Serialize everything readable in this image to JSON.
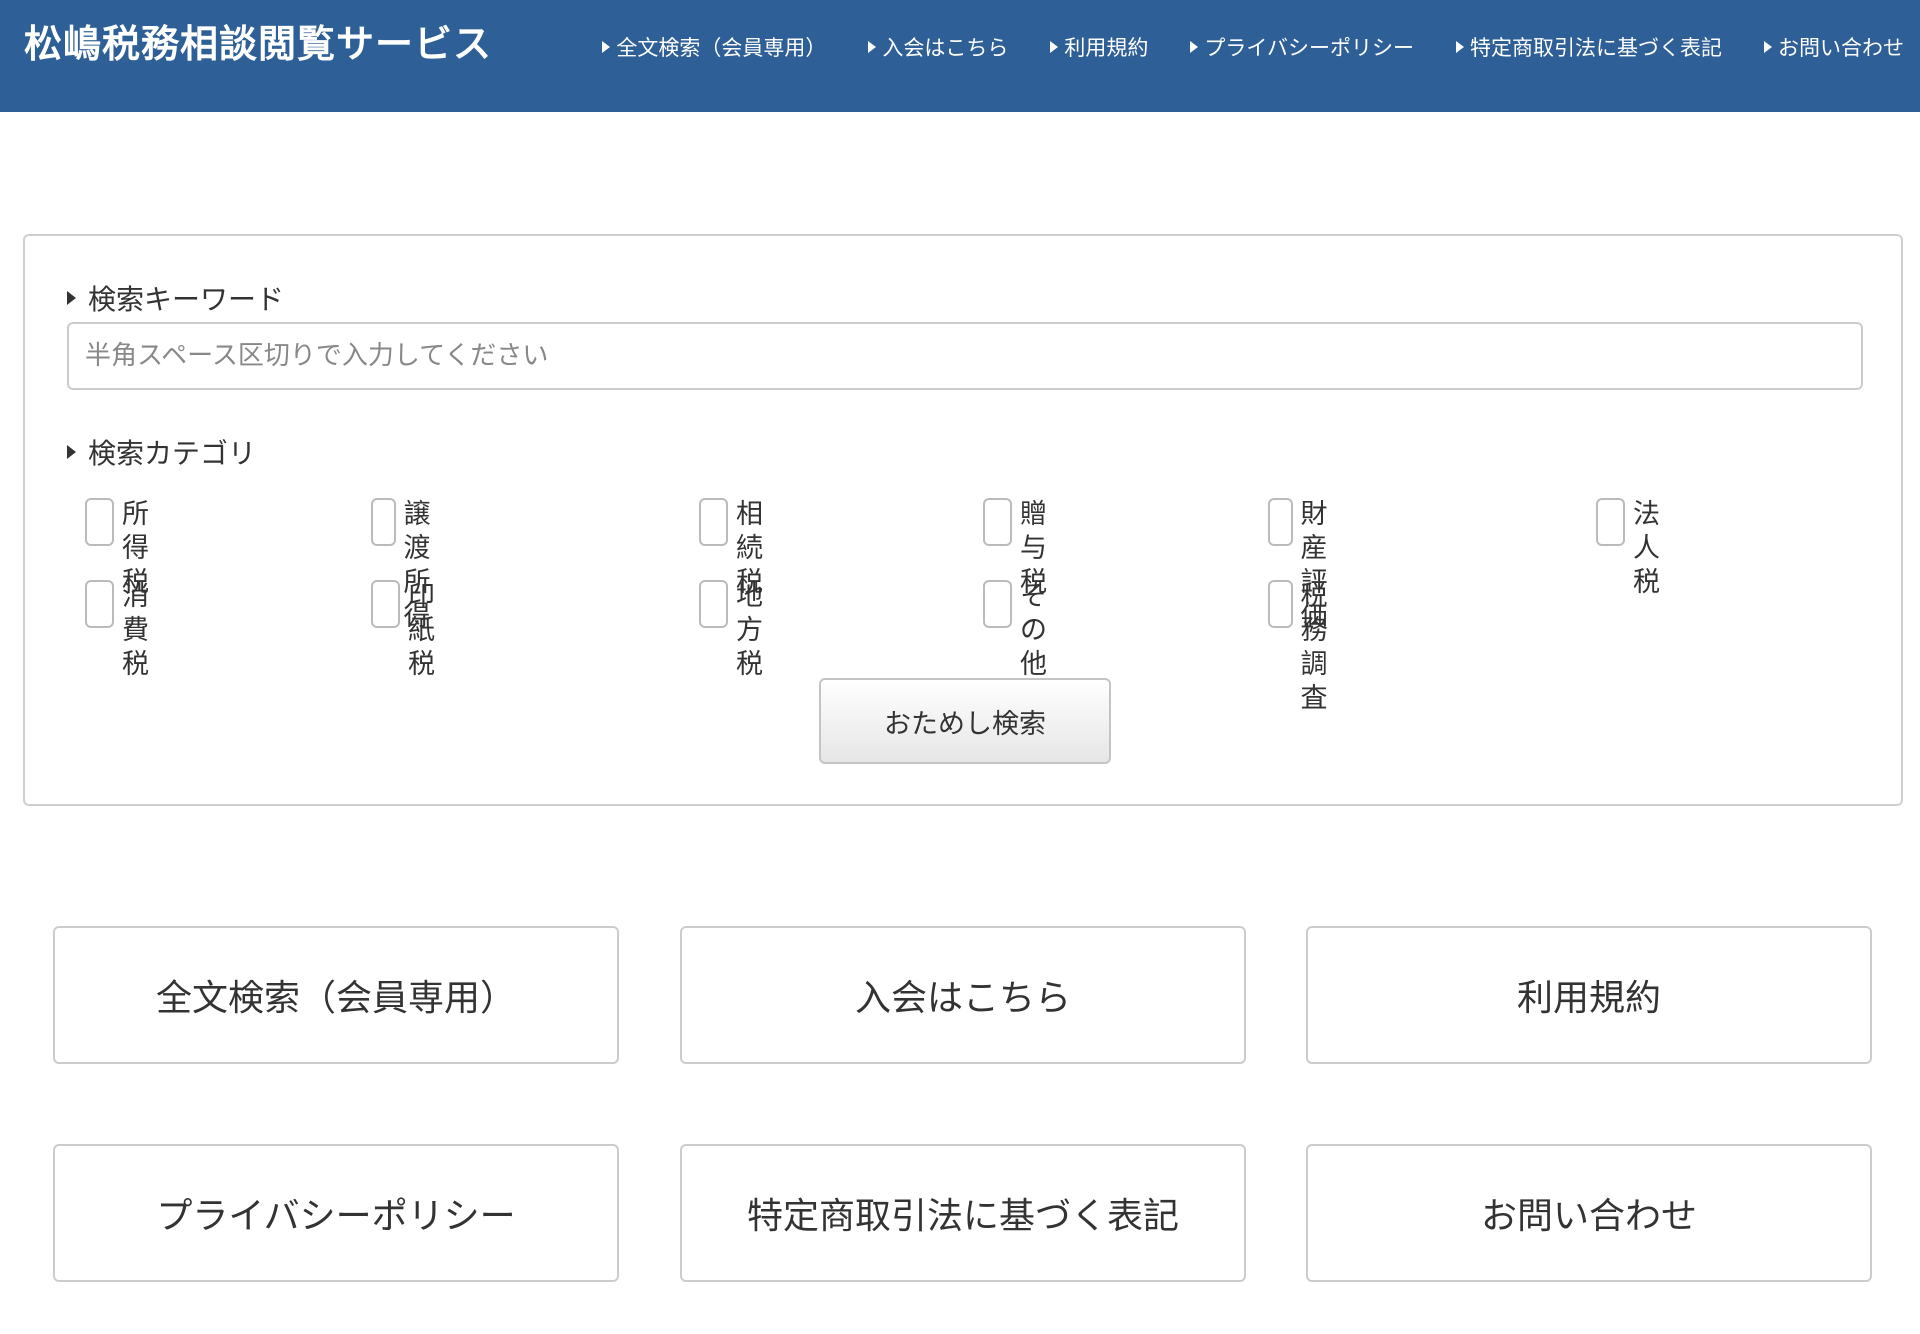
{
  "header": {
    "title": "松嶋税務相談閲覧サービス",
    "nav": [
      {
        "label": "全文検索（会員専用）"
      },
      {
        "label": "入会はこちら"
      },
      {
        "label": "利用規約"
      },
      {
        "label": "プライバシーポリシー"
      },
      {
        "label": "特定商取引法に基づく表記"
      },
      {
        "label": "お問い合わせ"
      }
    ]
  },
  "search": {
    "keyword_label": "検索キーワード",
    "keyword_value": "",
    "keyword_placeholder": "半角スペース区切りで入力してください",
    "category_label": "検索カテゴリ",
    "categories": [
      {
        "label": "所得税",
        "checked": false
      },
      {
        "label": "譲渡所得",
        "checked": false
      },
      {
        "label": "相続税",
        "checked": false
      },
      {
        "label": "贈与税",
        "checked": false
      },
      {
        "label": "財産評価",
        "checked": false
      },
      {
        "label": "法人税",
        "checked": false
      },
      {
        "label": "消費税",
        "checked": false
      },
      {
        "label": "印紙税",
        "checked": false
      },
      {
        "label": "地方税",
        "checked": false
      },
      {
        "label": "その他",
        "checked": false
      },
      {
        "label": "税務調査",
        "checked": false
      }
    ],
    "button_label": "おためし検索"
  },
  "tiles": [
    {
      "label": "全文検索（会員専用）"
    },
    {
      "label": "入会はこちら"
    },
    {
      "label": "利用規約"
    },
    {
      "label": "プライバシーポリシー"
    },
    {
      "label": "特定商取引法に基づく表記"
    },
    {
      "label": "お問い合わせ"
    }
  ]
}
